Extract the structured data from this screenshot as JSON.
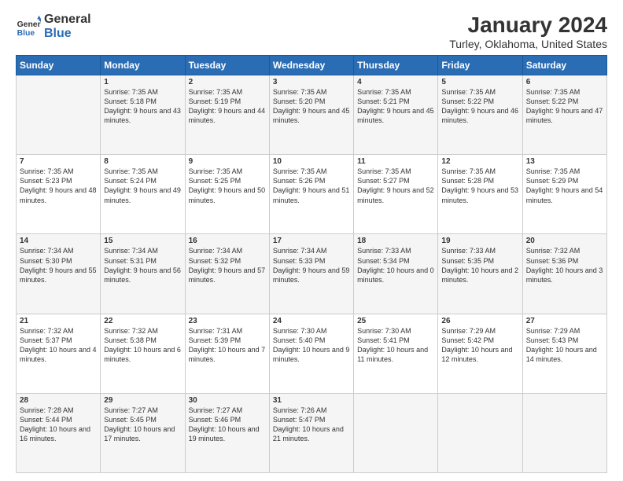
{
  "header": {
    "logo": {
      "line1": "General",
      "line2": "Blue"
    },
    "title": "January 2024",
    "subtitle": "Turley, Oklahoma, United States"
  },
  "calendar": {
    "days_of_week": [
      "Sunday",
      "Monday",
      "Tuesday",
      "Wednesday",
      "Thursday",
      "Friday",
      "Saturday"
    ],
    "weeks": [
      [
        {
          "day": "",
          "sunrise": "",
          "sunset": "",
          "daylight": ""
        },
        {
          "day": "1",
          "sunrise": "Sunrise: 7:35 AM",
          "sunset": "Sunset: 5:18 PM",
          "daylight": "Daylight: 9 hours and 43 minutes."
        },
        {
          "day": "2",
          "sunrise": "Sunrise: 7:35 AM",
          "sunset": "Sunset: 5:19 PM",
          "daylight": "Daylight: 9 hours and 44 minutes."
        },
        {
          "day": "3",
          "sunrise": "Sunrise: 7:35 AM",
          "sunset": "Sunset: 5:20 PM",
          "daylight": "Daylight: 9 hours and 45 minutes."
        },
        {
          "day": "4",
          "sunrise": "Sunrise: 7:35 AM",
          "sunset": "Sunset: 5:21 PM",
          "daylight": "Daylight: 9 hours and 45 minutes."
        },
        {
          "day": "5",
          "sunrise": "Sunrise: 7:35 AM",
          "sunset": "Sunset: 5:22 PM",
          "daylight": "Daylight: 9 hours and 46 minutes."
        },
        {
          "day": "6",
          "sunrise": "Sunrise: 7:35 AM",
          "sunset": "Sunset: 5:22 PM",
          "daylight": "Daylight: 9 hours and 47 minutes."
        }
      ],
      [
        {
          "day": "7",
          "sunrise": "Sunrise: 7:35 AM",
          "sunset": "Sunset: 5:23 PM",
          "daylight": "Daylight: 9 hours and 48 minutes."
        },
        {
          "day": "8",
          "sunrise": "Sunrise: 7:35 AM",
          "sunset": "Sunset: 5:24 PM",
          "daylight": "Daylight: 9 hours and 49 minutes."
        },
        {
          "day": "9",
          "sunrise": "Sunrise: 7:35 AM",
          "sunset": "Sunset: 5:25 PM",
          "daylight": "Daylight: 9 hours and 50 minutes."
        },
        {
          "day": "10",
          "sunrise": "Sunrise: 7:35 AM",
          "sunset": "Sunset: 5:26 PM",
          "daylight": "Daylight: 9 hours and 51 minutes."
        },
        {
          "day": "11",
          "sunrise": "Sunrise: 7:35 AM",
          "sunset": "Sunset: 5:27 PM",
          "daylight": "Daylight: 9 hours and 52 minutes."
        },
        {
          "day": "12",
          "sunrise": "Sunrise: 7:35 AM",
          "sunset": "Sunset: 5:28 PM",
          "daylight": "Daylight: 9 hours and 53 minutes."
        },
        {
          "day": "13",
          "sunrise": "Sunrise: 7:35 AM",
          "sunset": "Sunset: 5:29 PM",
          "daylight": "Daylight: 9 hours and 54 minutes."
        }
      ],
      [
        {
          "day": "14",
          "sunrise": "Sunrise: 7:34 AM",
          "sunset": "Sunset: 5:30 PM",
          "daylight": "Daylight: 9 hours and 55 minutes."
        },
        {
          "day": "15",
          "sunrise": "Sunrise: 7:34 AM",
          "sunset": "Sunset: 5:31 PM",
          "daylight": "Daylight: 9 hours and 56 minutes."
        },
        {
          "day": "16",
          "sunrise": "Sunrise: 7:34 AM",
          "sunset": "Sunset: 5:32 PM",
          "daylight": "Daylight: 9 hours and 57 minutes."
        },
        {
          "day": "17",
          "sunrise": "Sunrise: 7:34 AM",
          "sunset": "Sunset: 5:33 PM",
          "daylight": "Daylight: 9 hours and 59 minutes."
        },
        {
          "day": "18",
          "sunrise": "Sunrise: 7:33 AM",
          "sunset": "Sunset: 5:34 PM",
          "daylight": "Daylight: 10 hours and 0 minutes."
        },
        {
          "day": "19",
          "sunrise": "Sunrise: 7:33 AM",
          "sunset": "Sunset: 5:35 PM",
          "daylight": "Daylight: 10 hours and 2 minutes."
        },
        {
          "day": "20",
          "sunrise": "Sunrise: 7:32 AM",
          "sunset": "Sunset: 5:36 PM",
          "daylight": "Daylight: 10 hours and 3 minutes."
        }
      ],
      [
        {
          "day": "21",
          "sunrise": "Sunrise: 7:32 AM",
          "sunset": "Sunset: 5:37 PM",
          "daylight": "Daylight: 10 hours and 4 minutes."
        },
        {
          "day": "22",
          "sunrise": "Sunrise: 7:32 AM",
          "sunset": "Sunset: 5:38 PM",
          "daylight": "Daylight: 10 hours and 6 minutes."
        },
        {
          "day": "23",
          "sunrise": "Sunrise: 7:31 AM",
          "sunset": "Sunset: 5:39 PM",
          "daylight": "Daylight: 10 hours and 7 minutes."
        },
        {
          "day": "24",
          "sunrise": "Sunrise: 7:30 AM",
          "sunset": "Sunset: 5:40 PM",
          "daylight": "Daylight: 10 hours and 9 minutes."
        },
        {
          "day": "25",
          "sunrise": "Sunrise: 7:30 AM",
          "sunset": "Sunset: 5:41 PM",
          "daylight": "Daylight: 10 hours and 11 minutes."
        },
        {
          "day": "26",
          "sunrise": "Sunrise: 7:29 AM",
          "sunset": "Sunset: 5:42 PM",
          "daylight": "Daylight: 10 hours and 12 minutes."
        },
        {
          "day": "27",
          "sunrise": "Sunrise: 7:29 AM",
          "sunset": "Sunset: 5:43 PM",
          "daylight": "Daylight: 10 hours and 14 minutes."
        }
      ],
      [
        {
          "day": "28",
          "sunrise": "Sunrise: 7:28 AM",
          "sunset": "Sunset: 5:44 PM",
          "daylight": "Daylight: 10 hours and 16 minutes."
        },
        {
          "day": "29",
          "sunrise": "Sunrise: 7:27 AM",
          "sunset": "Sunset: 5:45 PM",
          "daylight": "Daylight: 10 hours and 17 minutes."
        },
        {
          "day": "30",
          "sunrise": "Sunrise: 7:27 AM",
          "sunset": "Sunset: 5:46 PM",
          "daylight": "Daylight: 10 hours and 19 minutes."
        },
        {
          "day": "31",
          "sunrise": "Sunrise: 7:26 AM",
          "sunset": "Sunset: 5:47 PM",
          "daylight": "Daylight: 10 hours and 21 minutes."
        },
        {
          "day": "",
          "sunrise": "",
          "sunset": "",
          "daylight": ""
        },
        {
          "day": "",
          "sunrise": "",
          "sunset": "",
          "daylight": ""
        },
        {
          "day": "",
          "sunrise": "",
          "sunset": "",
          "daylight": ""
        }
      ]
    ]
  }
}
